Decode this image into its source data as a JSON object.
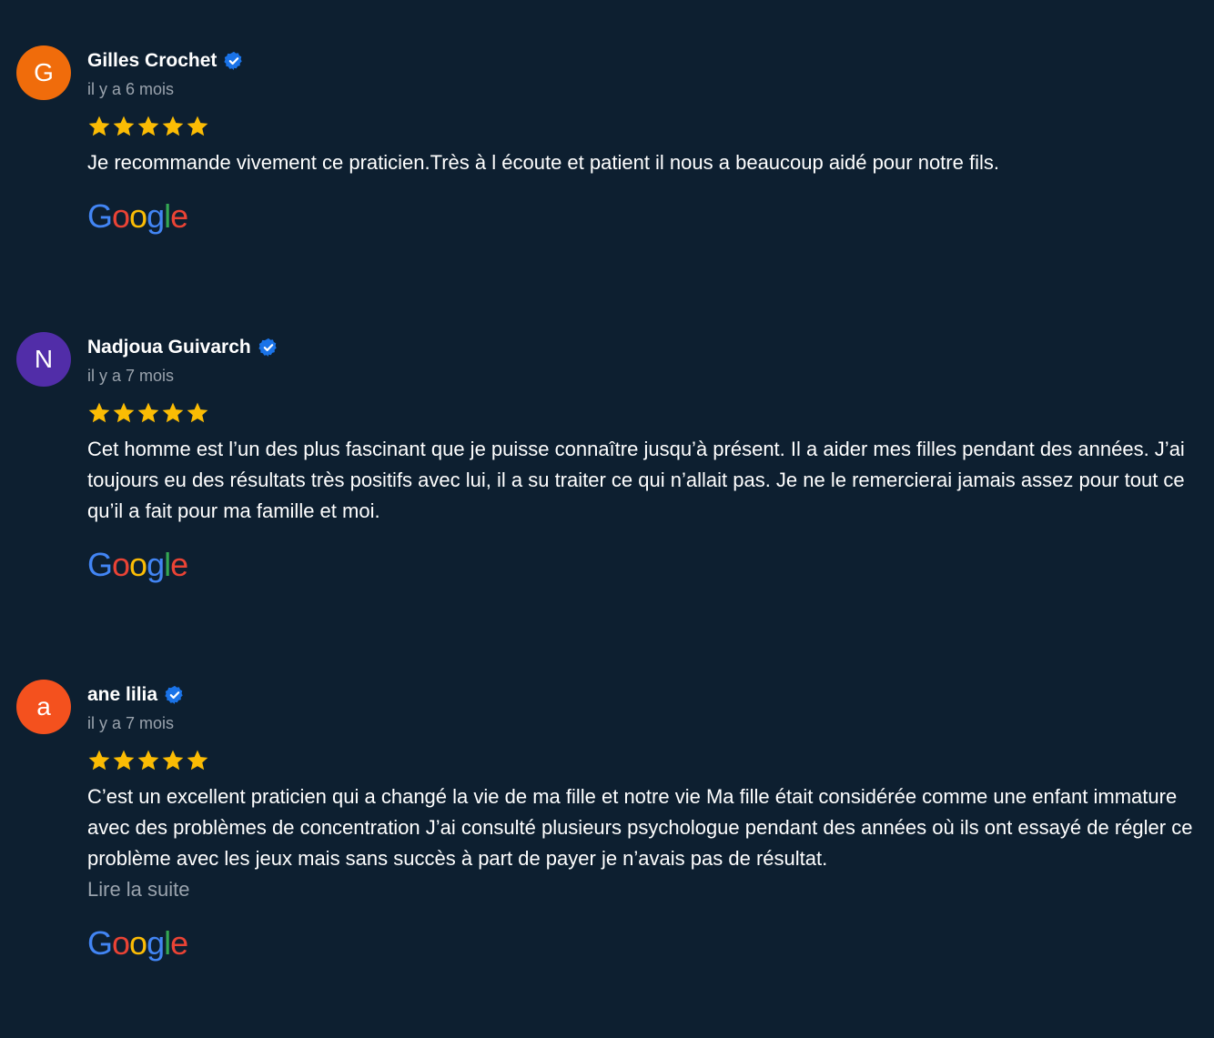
{
  "reviews": [
    {
      "initial": "G",
      "avatar_color": "#f06c0b",
      "name": "Gilles Crochet",
      "date": "il y a 6 mois",
      "rating": 5,
      "text": "Je recommande vivement ce praticien.Très à l écoute et patient il nous a beaucoup aidé pour notre fils.",
      "read_more": "",
      "source_icon": "google-logo"
    },
    {
      "initial": "N",
      "avatar_color": "#512da8",
      "name": "Nadjoua Guivarch",
      "date": "il y a 7 mois",
      "rating": 5,
      "text": "Cet homme est l’un des plus fascinant que je puisse connaître jusqu’à présent. Il a aider mes filles pendant des années. J’ai toujours eu des résultats très positifs avec lui, il a su traiter ce qui n’allait pas. Je ne le remercierai jamais assez pour tout ce qu’il a fait pour ma famille et moi.",
      "read_more": "",
      "source_icon": "google-logo"
    },
    {
      "initial": "a",
      "avatar_color": "#f4511e",
      "name": "ane lilia",
      "date": "il y a 7 mois",
      "rating": 5,
      "text": "C’est un excellent praticien qui a changé la vie de ma fille et notre vie Ma fille était considérée comme une enfant immature avec des problèmes de concentration J’ai consulté plusieurs psychologue pendant des années où ils ont essayé de régler ce problème avec les jeux mais sans succès à part de payer je n’avais pas de résultat.",
      "read_more": "Lire la suite",
      "source_icon": "google-logo"
    }
  ],
  "google_logo": {
    "letters": [
      "G",
      "o",
      "o",
      "g",
      "l",
      "e"
    ],
    "colors": [
      "#4285f4",
      "#ea4335",
      "#fbbc05",
      "#4285f4",
      "#34a853",
      "#ea4335"
    ]
  },
  "colors": {
    "background": "#0d1f30",
    "star": "#fbbc04",
    "verified": "#1a73e8",
    "muted_text": "#9aa3ad"
  },
  "icons": {
    "verified": "verified-badge-icon",
    "star": "star-icon"
  }
}
